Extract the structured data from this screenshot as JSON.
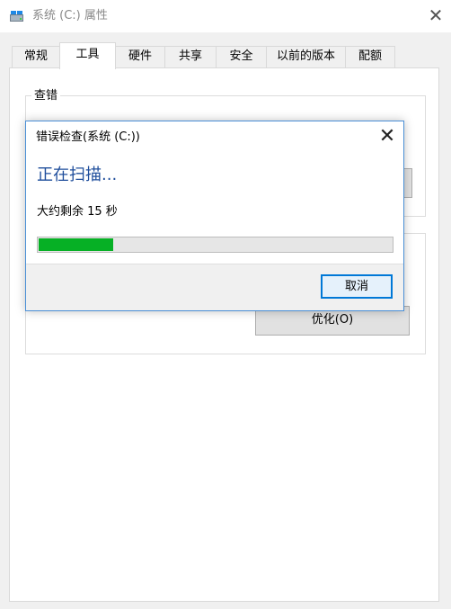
{
  "window": {
    "title": "系统 (C:) 属性",
    "close_glyph": "✕"
  },
  "tabs": [
    {
      "label": "常规",
      "active": false
    },
    {
      "label": "工具",
      "active": true
    },
    {
      "label": "硬件",
      "active": false
    },
    {
      "label": "共享",
      "active": false
    },
    {
      "label": "安全",
      "active": false
    },
    {
      "label": "以前的版本",
      "active": false
    },
    {
      "label": "配额",
      "active": false
    }
  ],
  "tools": {
    "error_checking_group_title": "查错",
    "optimize_button": "优化(O)"
  },
  "dialog": {
    "title": "错误检查(系统 (C:))",
    "close_glyph": "✕",
    "heading": "正在扫描...",
    "remaining": "大约剩余 15 秒",
    "progress_percent": 21,
    "cancel_label": "取消"
  },
  "colors": {
    "progress_fill": "#06b025",
    "heading_text": "#1f4e9c",
    "accent_border": "#0078d7"
  }
}
